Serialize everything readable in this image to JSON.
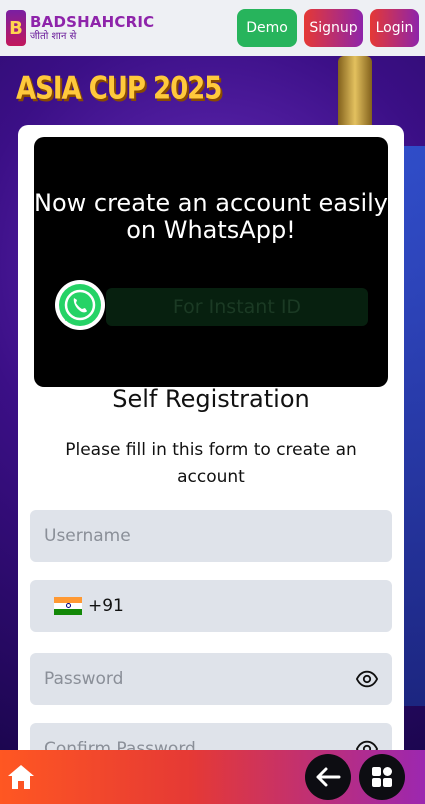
{
  "header": {
    "logo_mark": "B",
    "logo_name": "BADSHAHCRIC",
    "logo_tagline": "जीतो शान से",
    "demo_label": "Demo",
    "signup_label": "Signup",
    "login_label": "Login"
  },
  "banner": {
    "title": "ASIA CUP 2025"
  },
  "whatsapp_popup": {
    "title": "Now create an account easily on WhatsApp!",
    "instant_label": "For Instant ID",
    "icon": "whatsapp-icon"
  },
  "form": {
    "title": "Self Registration",
    "subtitle": "Please fill in this form to create an account",
    "username_placeholder": "Username",
    "phone_code": "+91",
    "password_placeholder": "Password",
    "confirm_password_placeholder": "Confirm Password"
  },
  "footer": {
    "home_icon": "home-icon",
    "back_icon": "arrow-left-icon",
    "apps_icon": "apps-icon"
  },
  "colors": {
    "demo": "#27b45c",
    "accent_start": "#e53935",
    "accent_end": "#8e24aa",
    "whatsapp": "#25d366",
    "field_bg": "#dfe3ea"
  }
}
